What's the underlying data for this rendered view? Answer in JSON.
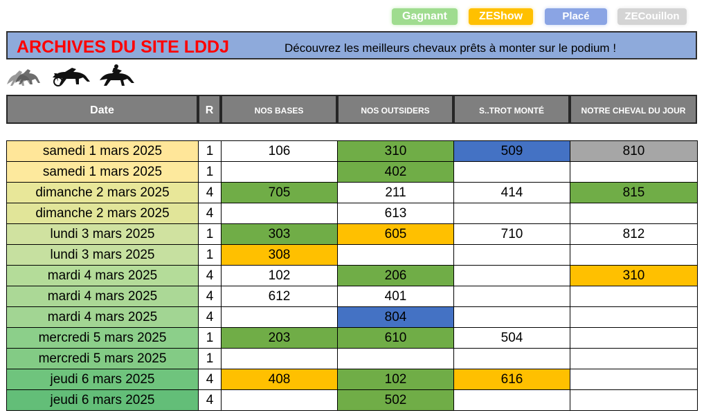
{
  "legend": {
    "gagnant": "Gagnant",
    "zeshow": "ZEShow",
    "place": "Placé",
    "zecouillon": "ZECouillon"
  },
  "colors": {
    "gagnant": "#70ad47",
    "zeshow": "#ffc000",
    "place": "#4472c4",
    "zecouillon": "#a6a6a6"
  },
  "banner": {
    "title": "ARCHIVES DU SITE LDDJ",
    "subtitle": "Découvrez les meilleurs chevaux prêts à monter sur le podium !"
  },
  "icons": [
    "galloping-horses-icon",
    "trotter-sulky-icon",
    "jockey-horse-icon"
  ],
  "headers": {
    "date": "Date",
    "r": "R",
    "bases": "NOS BASES",
    "outsiders": "NOS OUTSIDERS",
    "trot": "S..TROT MONTÉ",
    "cheval": "NOTRE  CHEVAL DU JOUR"
  },
  "rows": [
    {
      "date": "samedi 1 mars 2025",
      "r": "1",
      "cells": [
        [
          "106",
          ""
        ],
        [
          "310",
          "gagnant"
        ],
        [
          "509",
          "place"
        ],
        [
          "810",
          "zecouillon"
        ]
      ]
    },
    {
      "date": "samedi 1 mars 2025",
      "r": "1",
      "cells": [
        [
          "",
          ""
        ],
        [
          "402",
          "gagnant"
        ],
        [
          "",
          ""
        ],
        [
          "",
          ""
        ]
      ]
    },
    {
      "date": "dimanche 2 mars 2025",
      "r": "4",
      "cells": [
        [
          "705",
          "gagnant"
        ],
        [
          "211",
          ""
        ],
        [
          "414",
          ""
        ],
        [
          "815",
          "gagnant"
        ]
      ]
    },
    {
      "date": "dimanche 2 mars 2025",
      "r": "4",
      "cells": [
        [
          "",
          ""
        ],
        [
          "613",
          ""
        ],
        [
          "",
          ""
        ],
        [
          "",
          ""
        ]
      ]
    },
    {
      "date": "lundi 3 mars 2025",
      "r": "1",
      "cells": [
        [
          "303",
          "gagnant"
        ],
        [
          "605",
          "zeshow"
        ],
        [
          "710",
          ""
        ],
        [
          "812",
          ""
        ]
      ]
    },
    {
      "date": "lundi 3 mars 2025",
      "r": "1",
      "cells": [
        [
          "308",
          "zeshow"
        ],
        [
          "",
          ""
        ],
        [
          "",
          ""
        ],
        [
          "",
          ""
        ]
      ]
    },
    {
      "date": "mardi 4 mars 2025",
      "r": "4",
      "cells": [
        [
          "102",
          ""
        ],
        [
          "206",
          "gagnant"
        ],
        [
          "",
          ""
        ],
        [
          "310",
          "zeshow"
        ]
      ]
    },
    {
      "date": "mardi 4 mars 2025",
      "r": "4",
      "cells": [
        [
          "612",
          ""
        ],
        [
          "401",
          ""
        ],
        [
          "",
          ""
        ],
        [
          "",
          ""
        ]
      ]
    },
    {
      "date": "mardi 4 mars 2025",
      "r": "4",
      "cells": [
        [
          "",
          ""
        ],
        [
          "804",
          "place"
        ],
        [
          "",
          ""
        ],
        [
          "",
          ""
        ]
      ]
    },
    {
      "date": "mercredi 5 mars 2025",
      "r": "1",
      "cells": [
        [
          "203",
          "gagnant"
        ],
        [
          "610",
          "gagnant"
        ],
        [
          "504",
          ""
        ],
        [
          "",
          ""
        ]
      ]
    },
    {
      "date": "mercredi 5 mars 2025",
      "r": "1",
      "cells": [
        [
          "",
          ""
        ],
        [
          "",
          ""
        ],
        [
          "",
          ""
        ],
        [
          "",
          ""
        ]
      ]
    },
    {
      "date": "jeudi 6 mars 2025",
      "r": "4",
      "cells": [
        [
          "408",
          "zeshow"
        ],
        [
          "102",
          "gagnant"
        ],
        [
          "616",
          "zeshow"
        ],
        [
          "",
          ""
        ]
      ]
    },
    {
      "date": "jeudi 6 mars 2025",
      "r": "4",
      "cells": [
        [
          "",
          ""
        ],
        [
          "502",
          "gagnant"
        ],
        [
          "",
          ""
        ],
        [
          "",
          ""
        ]
      ]
    }
  ],
  "date_colors": [
    "#ffe699",
    "#fde99d",
    "#e8e799",
    "#e1e599",
    "#d0e2a0",
    "#c6e0a0",
    "#b4dc99",
    "#abd896",
    "#a2d593",
    "#8ccf8a",
    "#83cb85",
    "#6fc47d",
    "#63be78"
  ]
}
